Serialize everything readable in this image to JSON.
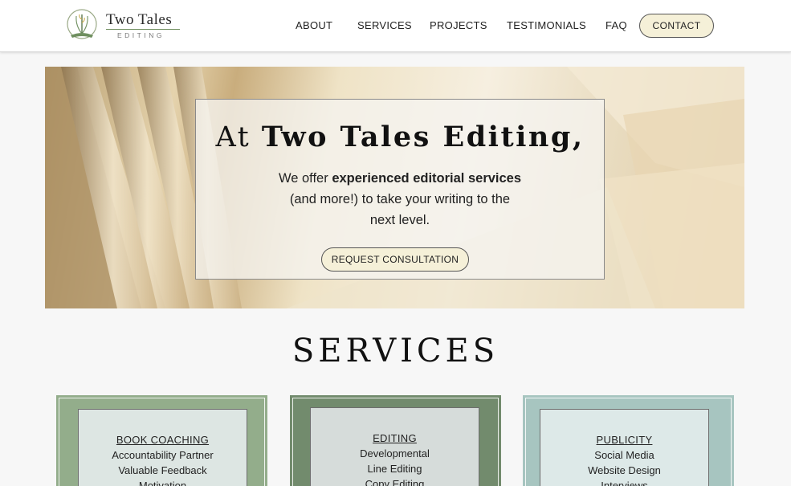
{
  "brand": {
    "title": "Two Tales",
    "subtitle": "EDITING",
    "accent": "#6f8f5f"
  },
  "nav": {
    "items": [
      "ABOUT",
      "SERVICES",
      "PROJECTS",
      "TESTIMONIALS",
      "FAQ"
    ],
    "contact_label": "CONTACT"
  },
  "hero": {
    "title_lead": "At",
    "title_strong": "Two Tales Editing,",
    "line1_plain": "We offer ",
    "line1_bold": "experienced editorial services",
    "line2": "(and more!) to take your writing to the",
    "line3": "next level.",
    "cta_label": "REQUEST CONSULTATION"
  },
  "services": {
    "heading": "SERVICES",
    "cards": [
      {
        "title": "BOOK COACHING",
        "items": [
          "Accountability Partner",
          "Valuable Feedback",
          "Motivation"
        ],
        "color": "#93ad8b"
      },
      {
        "title": "EDITING",
        "items": [
          "Developmental",
          "Line Editing",
          "Copy Editing"
        ],
        "color": "#728b6d"
      },
      {
        "title": "PUBLICITY",
        "items": [
          "Social Media",
          "Website Design",
          "Interviews"
        ],
        "color": "#a7c5c0"
      }
    ]
  },
  "colors": {
    "button_fill": "#f5f0d8",
    "card_inner": "#dde6e3"
  }
}
